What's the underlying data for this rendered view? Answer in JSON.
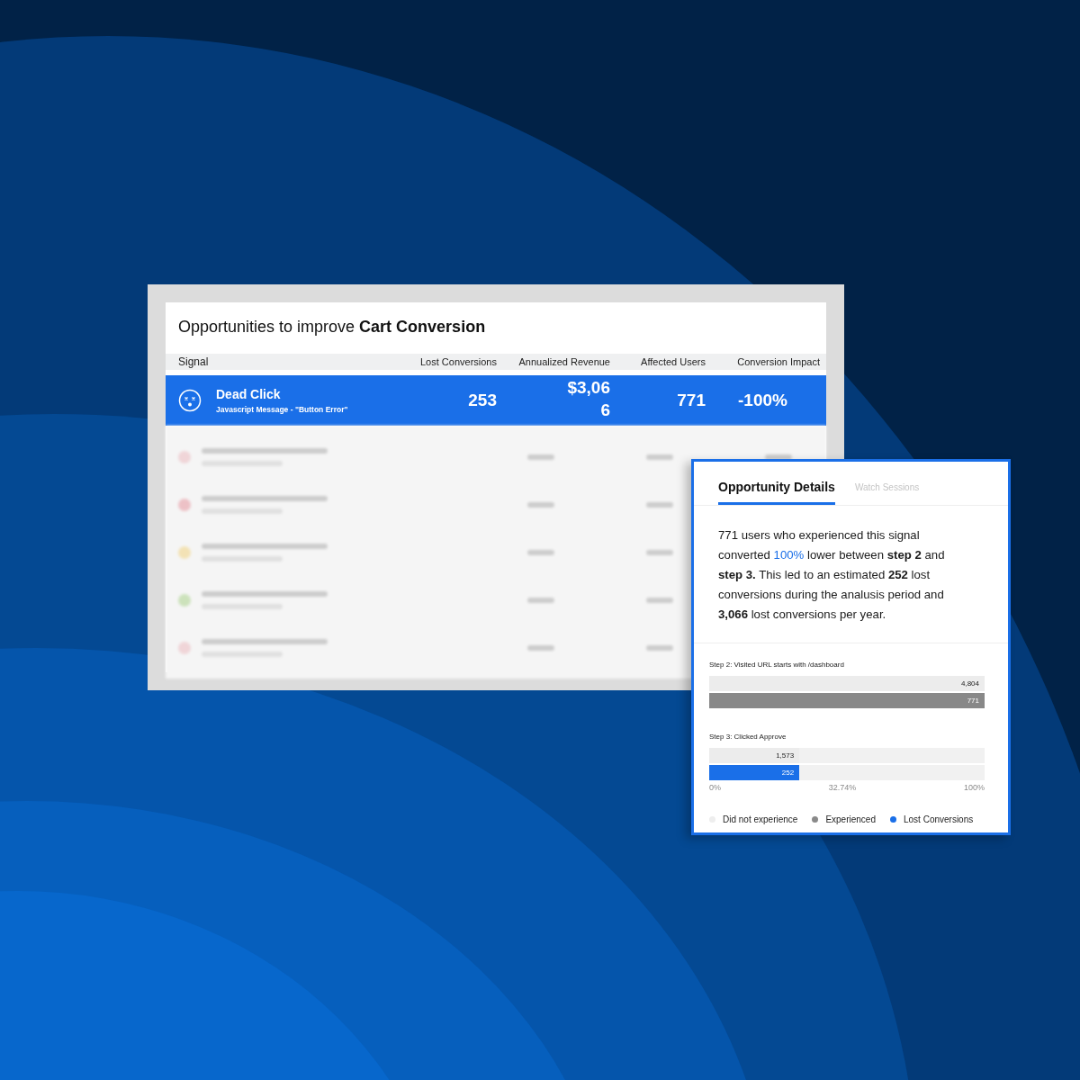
{
  "opportunities": {
    "title": "Opportunities to improve **Cart Conversion**",
    "columns": [
      "Signal",
      "Lost Conversions",
      "Annualized Revenue",
      "Affected Users",
      "Conversion Impact"
    ],
    "rows": [
      {
        "name": "Dead Click",
        "detail": "Javascript  Message - \"Button Error\"",
        "lost_conversions": "253",
        "annualized_revenue": "$3,066",
        "affected_users": "771",
        "conversion_impact": "-100%",
        "selected": true
      }
    ]
  },
  "details": {
    "tabs": [
      {
        "label": "Opportunity Details",
        "selected": true
      },
      {
        "label": "Watch Sessions",
        "selected": false
      }
    ],
    "summary": [
      {
        "kind": "plain",
        "text": "771 users who experienced this signal converted "
      },
      {
        "kind": "accent",
        "text": "100%"
      },
      {
        "kind": "plain",
        "text": " lower between "
      },
      {
        "kind": "bold",
        "text": "step 2"
      },
      {
        "kind": "plain",
        "text": " and "
      },
      {
        "kind": "bold",
        "text": "step 3."
      },
      {
        "kind": "plain",
        "text": " This led to an estimated "
      },
      {
        "kind": "bold",
        "text": "252"
      },
      {
        "kind": "plain",
        "text": " lost conversions during the analusis period and "
      },
      {
        "kind": "bold",
        "text": "3,066"
      },
      {
        "kind": "plain",
        "text": " lost conversions per year."
      }
    ],
    "steps": [
      {
        "label": "Step 2: Visited URL starts with /dashboard",
        "bars": [
          {
            "kind": "total",
            "value": "4,804",
            "level": 1
          },
          {
            "kind": "experienced",
            "value": "771",
            "level": 1
          }
        ]
      },
      {
        "label": "Step 3: Clicked Approve",
        "bars": [
          {
            "kind": "total",
            "value": "1,573",
            "level": 0.3274
          },
          {
            "kind": "lost",
            "value": "252",
            "level": 0.3274
          }
        ]
      }
    ],
    "axis_ticks": [
      "0%",
      "32.74%",
      "100%"
    ],
    "legend": [
      {
        "label": "Did not experience",
        "color": "#eeeeee"
      },
      {
        "label": "Experienced",
        "color": "#8a8a8a"
      },
      {
        "label": "Lost Conversions",
        "color": "#1a6fe8"
      }
    ]
  }
}
